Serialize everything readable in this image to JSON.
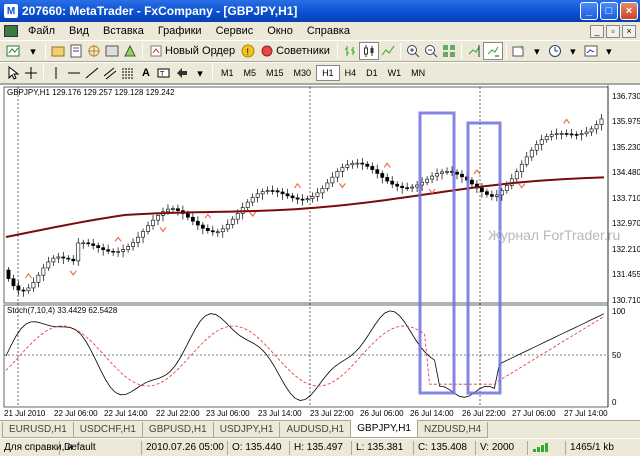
{
  "window": {
    "title": "207660: MetaTrader - FxCompany - [GBPJPY,H1]"
  },
  "menu": [
    "Файл",
    "Вид",
    "Вставка",
    "Графики",
    "Сервис",
    "Окно",
    "Справка"
  ],
  "toolbar1": {
    "new_order": "Новый Ордер",
    "advisors": "Советники"
  },
  "timeframes": [
    "M1",
    "M5",
    "M15",
    "M30",
    "H1",
    "H4",
    "D1",
    "W1",
    "MN"
  ],
  "active_timeframe": "H1",
  "chart": {
    "header": "GBPJPY,H1  129.176 129.257 129.128 129.242",
    "last_price": "136.730",
    "price_ticks": [
      "136.730",
      "135.975",
      "135.230",
      "134.480",
      "133.710",
      "132.970",
      "132.210",
      "131.455",
      "130.710"
    ],
    "stoch_header": "Stoch(7,10,4) 33.4429 62.5428",
    "stoch_ticks": [
      "100",
      "50",
      "0"
    ],
    "time_ticks": [
      "21 Jul 2010",
      "22 Jul 06:00",
      "22 Jul 14:00",
      "22 Jul 22:00",
      "23 Jul 06:00",
      "23 Jul 14:00",
      "23 Jul 22:00",
      "26 Jul 06:00",
      "26 Jul 14:00",
      "26 Jul 22:00",
      "27 Jul 06:00",
      "27 Jul 14:00"
    ],
    "watermark": "Журнал ForTrader.ru",
    "colors": {
      "ma": "#7a0c0c",
      "stoch_main": "#000000",
      "stoch_signal": "#e03030",
      "fractal": "#f07050",
      "highlight": "#7070e0"
    }
  },
  "tabs": [
    "EURUSD,H1",
    "USDCHF,H1",
    "GBPUSD,H1",
    "USDJPY,H1",
    "AUDUSD,H1",
    "GBPJPY,H1",
    "NZDUSD,H4"
  ],
  "active_tab": "GBPJPY,H1",
  "status": {
    "help": "Для справки, н",
    "profile": "Default",
    "datetime": "2010.07.26 05:00",
    "open": "O: 135.440",
    "high": "H: 135.497",
    "low": "L: 135.381",
    "close": "C: 135.408",
    "volume": "V: 2000",
    "traffic": "1465/1 kb"
  }
}
